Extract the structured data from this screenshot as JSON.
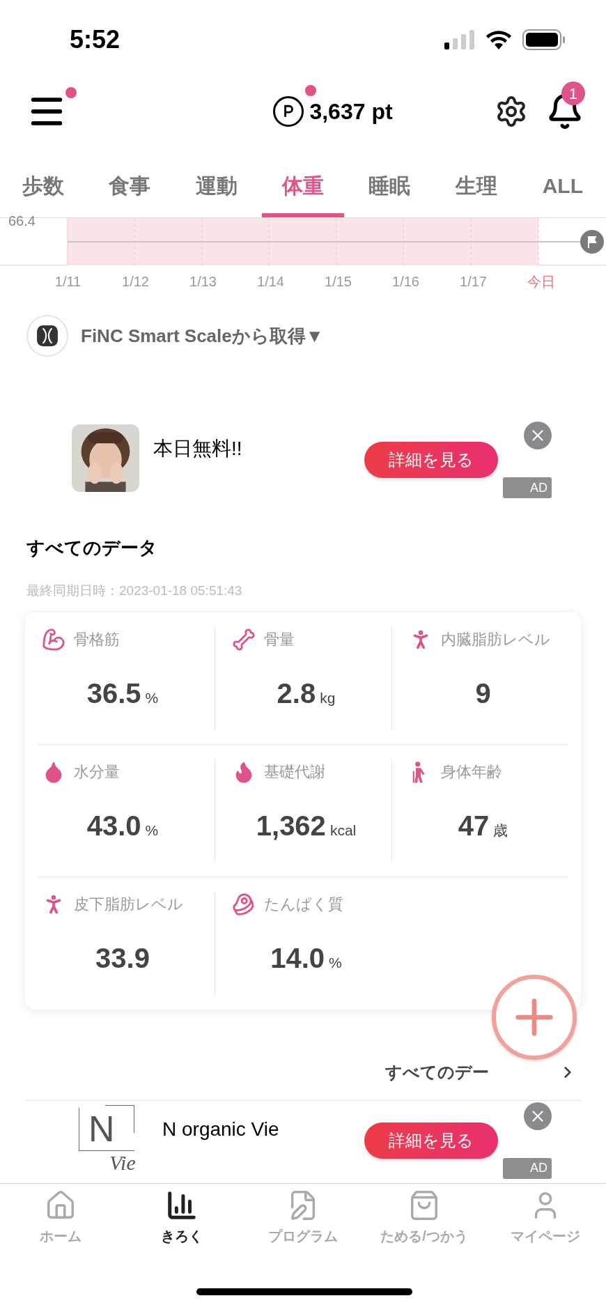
{
  "status_bar": {
    "time": "5:52"
  },
  "header": {
    "menu_badge": true,
    "points": "3,637 pt",
    "points_badge": true,
    "notification_count": "1"
  },
  "tabs": [
    {
      "label": "歩数",
      "selected": false
    },
    {
      "label": "食事",
      "selected": false
    },
    {
      "label": "運動",
      "selected": false
    },
    {
      "label": "体重",
      "selected": true
    },
    {
      "label": "睡眠",
      "selected": false
    },
    {
      "label": "生理",
      "selected": false
    },
    {
      "label": "ALL",
      "selected": false
    }
  ],
  "chart": {
    "y_label": "66.4",
    "x_labels": [
      {
        "label": "1/11",
        "highlighted": false
      },
      {
        "label": "1/12",
        "highlighted": false
      },
      {
        "label": "1/13",
        "highlighted": false
      },
      {
        "label": "1/14",
        "highlighted": false
      },
      {
        "label": "1/15",
        "highlighted": false
      },
      {
        "label": "1/16",
        "highlighted": false
      },
      {
        "label": "1/17",
        "highlighted": false
      },
      {
        "label": "今日",
        "highlighted": true
      }
    ]
  },
  "source": {
    "label": "FiNC Smart Scaleから取得▼"
  },
  "ads": [
    {
      "title": "本日無料!!",
      "button": "詳細を見る",
      "badge": "AD"
    },
    {
      "title": "N organic Vie",
      "button": "詳細を見る",
      "badge": "AD",
      "image": {
        "kind": "logo",
        "letter": "N",
        "script": "Vie"
      }
    }
  ],
  "all_data": {
    "title": "すべてのデータ",
    "synced": "最終同期日時：2023-01-18 05:51:43",
    "link": "すべてのデー",
    "metrics": [
      {
        "kind": "muscle",
        "label": "骨格筋",
        "value": "36.5",
        "unit": "%"
      },
      {
        "kind": "bone",
        "label": "骨量",
        "value": "2.8",
        "unit": "kg"
      },
      {
        "kind": "visceral",
        "label": "内臓脂肪レベル",
        "value": "9"
      },
      {
        "kind": "water",
        "label": "水分量",
        "value": "43.0",
        "unit": "%"
      },
      {
        "kind": "metabolism",
        "label": "基礎代謝",
        "value": "1,362",
        "unit": "kcal"
      },
      {
        "kind": "age",
        "label": "身体年齢",
        "value": "47",
        "unit": "歳"
      },
      {
        "kind": "subcutaneous",
        "label": "皮下脂肪レベル",
        "value": "33.9"
      },
      {
        "kind": "protein",
        "label": "たんぱく質",
        "value": "14.0",
        "unit": "%"
      }
    ]
  },
  "bottom_nav": [
    {
      "kind": "home",
      "label": "ホーム",
      "selected": false
    },
    {
      "kind": "record",
      "label": "きろく",
      "selected": true
    },
    {
      "kind": "program",
      "label": "プログラム",
      "selected": false
    },
    {
      "kind": "points",
      "label": "ためる/つかう",
      "selected": false
    },
    {
      "kind": "mypage",
      "label": "マイページ",
      "selected": false
    }
  ]
}
